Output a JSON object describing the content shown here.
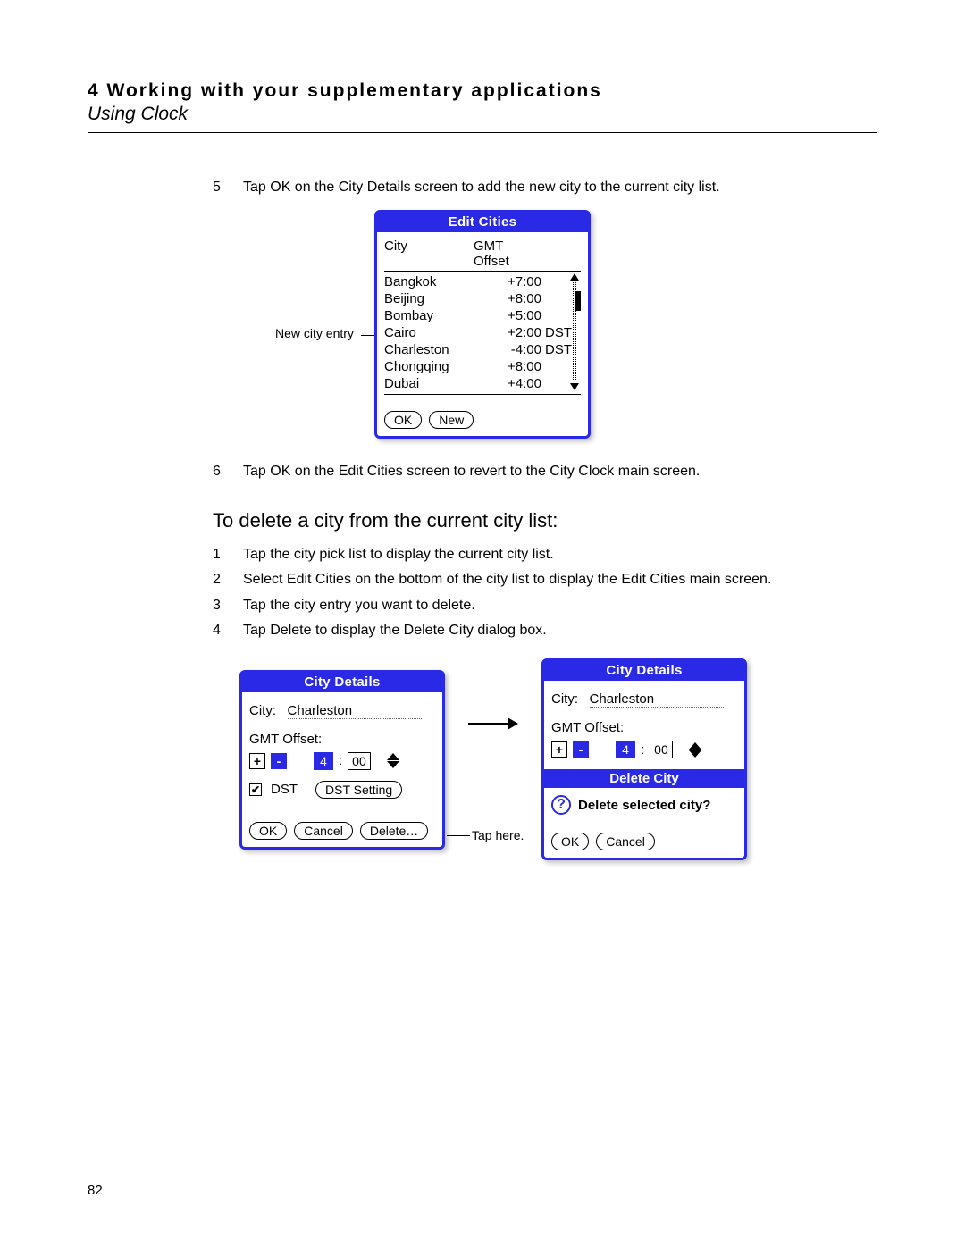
{
  "header": {
    "chapter": "4 Working with your supplementary applications",
    "section": "Using Clock"
  },
  "steps_a": [
    {
      "n": "5",
      "t": "Tap OK on the City Details screen to add the new city to the current city list."
    }
  ],
  "edit_cities": {
    "title": "Edit Cities",
    "col_city": "City",
    "col_gmt": "GMT Offset",
    "rows": [
      {
        "city": "Bangkok",
        "off": "+7:00",
        "dst": ""
      },
      {
        "city": "Beijing",
        "off": "+8:00",
        "dst": ""
      },
      {
        "city": "Bombay",
        "off": "+5:00",
        "dst": ""
      },
      {
        "city": "Cairo",
        "off": "+2:00",
        "dst": "DST"
      },
      {
        "city": "Charleston",
        "off": "-4:00",
        "dst": "DST"
      },
      {
        "city": "Chongqing",
        "off": "+8:00",
        "dst": ""
      },
      {
        "city": "Dubai",
        "off": "+4:00",
        "dst": ""
      }
    ],
    "ok": "OK",
    "new": "New",
    "callout": "New city entry"
  },
  "steps_b": [
    {
      "n": "6",
      "t": "Tap OK on the Edit Cities screen to revert to the City Clock main screen."
    }
  ],
  "subhead": "To delete a city from the current city list:",
  "steps_c": [
    {
      "n": "1",
      "t": "Tap the city pick list to display the current city list."
    },
    {
      "n": "2",
      "t": "Select Edit Cities on the bottom of the city list to display the Edit Cities main screen."
    },
    {
      "n": "3",
      "t": "Tap the city entry you want to delete."
    },
    {
      "n": "4",
      "t": "Tap Delete to display the Delete City dialog box."
    }
  ],
  "city_details": {
    "title": "City Details",
    "city_label": "City:",
    "city_value": "Charleston",
    "gmt_label": "GMT Offset:",
    "hour": "4",
    "min": "00",
    "dst_label": "DST",
    "dst_setting": "DST Setting",
    "ok": "OK",
    "cancel": "Cancel",
    "delete": "Delete…",
    "tap_here": "Tap here.",
    "delete_city_header": "Delete City",
    "delete_prompt": "Delete selected city?"
  },
  "page_number": "82"
}
